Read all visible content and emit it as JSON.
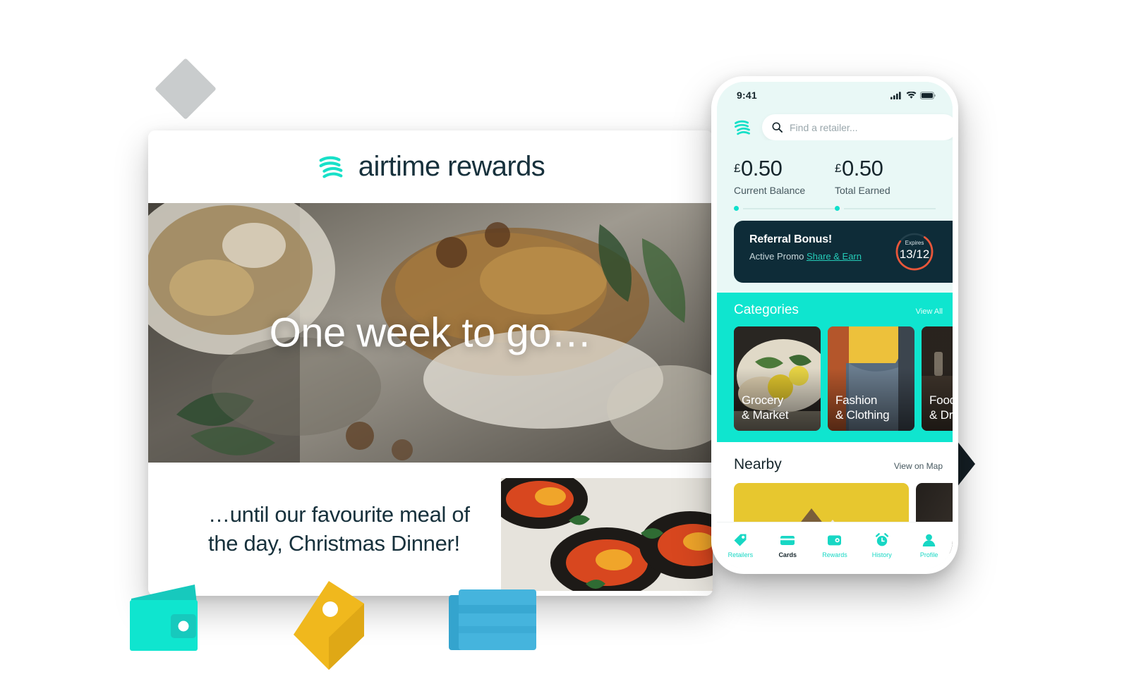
{
  "brand_colors": {
    "teal": "#0fe5cf",
    "teal_dark": "#17c9bd",
    "navy": "#0e2c38",
    "ink": "#16262c",
    "mint_bg": "#e9f8f6",
    "orange": "#e8563a",
    "yellow": "#f0b81d",
    "blue": "#45b4dd"
  },
  "window": {
    "brand": "airtime rewards",
    "hero_headline": "One week to go…",
    "caption": "…until our favourite meal of the day, Christmas Dinner!"
  },
  "phone": {
    "status_bar": {
      "time": "9:41",
      "icons": [
        "cellular-signal-icon",
        "wifi-icon",
        "battery-icon"
      ]
    },
    "search": {
      "placeholder": "Find a retailer...",
      "icon": "search-icon"
    },
    "balances": [
      {
        "currency": "£",
        "amount": "0.50",
        "label": "Current Balance"
      },
      {
        "currency": "£",
        "amount": "0.50",
        "label": "Total Earned"
      }
    ],
    "promo": {
      "title": "Referral Bonus!",
      "status": "Active Promo",
      "link": "Share & Earn",
      "expires_label": "Expires",
      "expires_date": "13/12"
    },
    "categories": {
      "title": "Categories",
      "view_all": "View All",
      "items": [
        {
          "line1": "Grocery",
          "line2": "& Market"
        },
        {
          "line1": "Fashion",
          "line2": "& Clothing"
        },
        {
          "line1": "Food",
          "line2": "& Drink"
        }
      ]
    },
    "nearby": {
      "title": "Nearby",
      "view_on_map": "View on Map"
    },
    "tabs": [
      {
        "label": "Retailers",
        "icon": "tag-icon",
        "active": false
      },
      {
        "label": "Cards",
        "icon": "card-icon",
        "active": true
      },
      {
        "label": "Rewards",
        "icon": "wallet-icon",
        "active": false
      },
      {
        "label": "History",
        "icon": "alarm-clock-icon",
        "active": false
      },
      {
        "label": "Profile",
        "icon": "person-icon",
        "active": false
      }
    ]
  },
  "decorations": [
    "wifi-arcs-decoration",
    "diamond-decoration",
    "arrow-right-decoration",
    "wallet-decoration-icon",
    "price-tag-decoration-icon",
    "cards-stack-decoration-icon"
  ]
}
